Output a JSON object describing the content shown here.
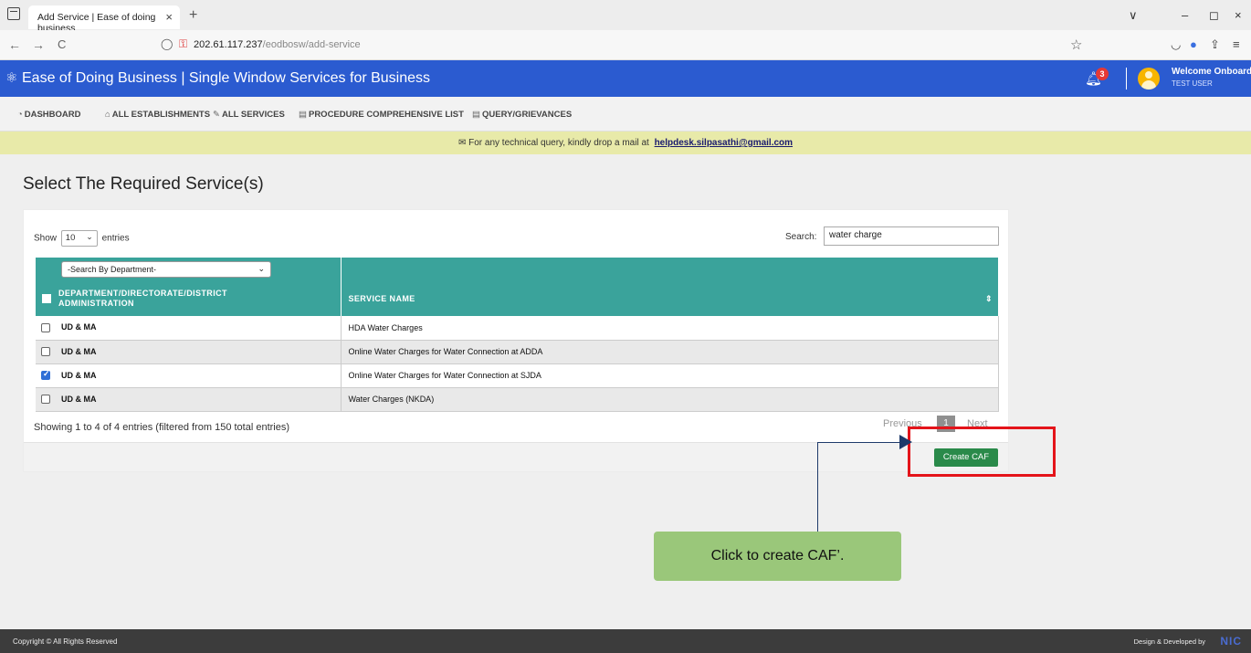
{
  "browser": {
    "tab_title": "Add Service | Ease of doing business",
    "tab_close": "×",
    "new_tab": "+",
    "url_host": "202.61.117.237",
    "url_path": "/eodbosw/add-service",
    "back_icon": "←",
    "forward_icon": "→",
    "reload_icon": "C",
    "window_controls": [
      "∨",
      "–",
      "◻",
      "×"
    ]
  },
  "header": {
    "title": "Ease of Doing Business | Single Window Services for Business",
    "notification_count": "3",
    "welcome": "Welcome Onboard",
    "user": "TEST USER"
  },
  "menu": {
    "items": [
      {
        "icon": "dashboard-icon",
        "label": "DASHBOARD"
      },
      {
        "icon": "building-icon",
        "label": "ALL ESTABLISHMENTS"
      },
      {
        "icon": "wrench-icon",
        "label": "ALL SERVICES"
      },
      {
        "icon": "list-icon",
        "label": "PROCEDURE COMPREHENSIVE LIST"
      },
      {
        "icon": "list-icon",
        "label": "QUERY/GRIEVANCES"
      }
    ]
  },
  "notice": {
    "text": "For any technical query, kindly drop a mail at",
    "email": "helpdesk.silpasathi@gmail.com"
  },
  "page": {
    "title": "Select The Required Service(s)"
  },
  "table_controls": {
    "show_label": "Show",
    "entries_value": "10",
    "entries_label": "entries",
    "search_label": "Search:",
    "search_value": "water charge",
    "dept_filter_placeholder": "-Search By Department-"
  },
  "table": {
    "headers": [
      "DEPARTMENT/DIRECTORATE/DISTRICT ADMINISTRATION",
      "SERVICE NAME"
    ],
    "rows": [
      {
        "dept": "UD & MA",
        "service": "HDA Water Charges",
        "checked": false
      },
      {
        "dept": "UD & MA",
        "service": "Online Water Charges for Water Connection at ADDA",
        "checked": false
      },
      {
        "dept": "UD & MA",
        "service": "Online Water Charges for Water Connection at SJDA",
        "checked": true
      },
      {
        "dept": "UD & MA",
        "service": "Water Charges (NKDA)",
        "checked": false
      }
    ]
  },
  "pagination": {
    "info": "Showing 1 to 4 of 4 entries (filtered from 150 total entries)",
    "previous": "Previous",
    "page": "1",
    "next": "Next"
  },
  "actions": {
    "create_caf": "Create CAF"
  },
  "annotation": {
    "callout_text": "Click to create CAF’."
  },
  "footer": {
    "copyright": "Copyright © All Rights Reserved",
    "design": "Design & Developed by",
    "logo": "NIC"
  }
}
